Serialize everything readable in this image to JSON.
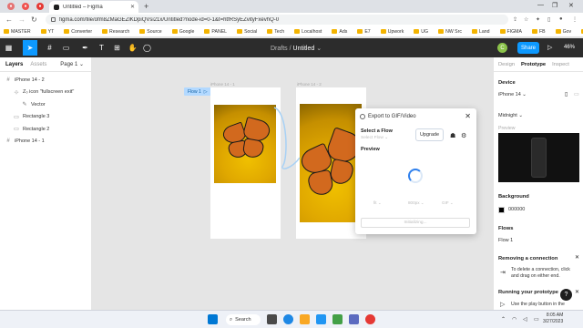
{
  "browser": {
    "tab_title": "Untitled – Figma",
    "url": "figma.com/file/ofm8ZMaGEZlKDpiQVsi21x/Untitled?node-id=0-1&t=htfRSyEZvityFxevhQ-0",
    "bookmarks": [
      "MASTER",
      "YT",
      "Converter",
      "Research",
      "Source",
      "Google",
      "PANEL",
      "Social",
      "Tech",
      "Localhost",
      "Ads",
      "E7",
      "Upwork",
      "UG",
      "NW Src",
      "Land",
      "FIGMA",
      "FB",
      "Gov",
      "Elementor"
    ]
  },
  "toolbar": {
    "drafts": "Drafts",
    "separator": "/",
    "file_name": "Untitled",
    "chevron": "⌄",
    "avatar_initial": "C",
    "share_label": "Share",
    "zoom": "46%"
  },
  "left_panel": {
    "tabs": [
      "Layers",
      "Assets"
    ],
    "page": "Page 1",
    "layers": [
      {
        "icon": "#",
        "label": "iPhone 14 - 2",
        "indent": 0
      },
      {
        "icon": "⊹",
        "label": "Z₀ icon \"fullscreen exit\"",
        "indent": 1
      },
      {
        "icon": "✎",
        "label": "Vector",
        "indent": 2
      },
      {
        "icon": "▭",
        "label": "Rectangle 3",
        "indent": 1
      },
      {
        "icon": "▭",
        "label": "Rectangle 2",
        "indent": 1
      },
      {
        "icon": "#",
        "label": "iPhone 14 - 1",
        "indent": 0
      }
    ]
  },
  "canvas": {
    "flow_tag": "Flow 1",
    "frame_labels": [
      "iPhone 14 - 1",
      "iPhone 14 - 2"
    ]
  },
  "dialog": {
    "title": "Export to GIF/Video",
    "select_flow_label": "Select a Flow",
    "select_flow_value": "Select Flow",
    "upgrade_label": "Upgrade",
    "preview_label": "Preview",
    "options": [
      "fit ⌄",
      "800px ⌄",
      "GIF ⌄"
    ],
    "initialize_label": "Initializing..."
  },
  "right_panel": {
    "tabs": [
      "Design",
      "Prototype",
      "Inspect"
    ],
    "device_heading": "Device",
    "device_value": "iPhone 14",
    "model_value": "Midnight",
    "preview_heading": "Preview",
    "background_heading": "Background",
    "background_value": "000000",
    "flows_heading": "Flows",
    "flow_item": "Flow 1",
    "removing_heading": "Removing a connection",
    "removing_hint": "To delete a connection, click and drag on either end.",
    "running_heading": "Running your prototype",
    "running_hint": "Use the play button in the",
    "help_label": "?"
  },
  "taskbar": {
    "search_label": "Search",
    "time": "8:05 AM",
    "date": "3/27/2023"
  }
}
